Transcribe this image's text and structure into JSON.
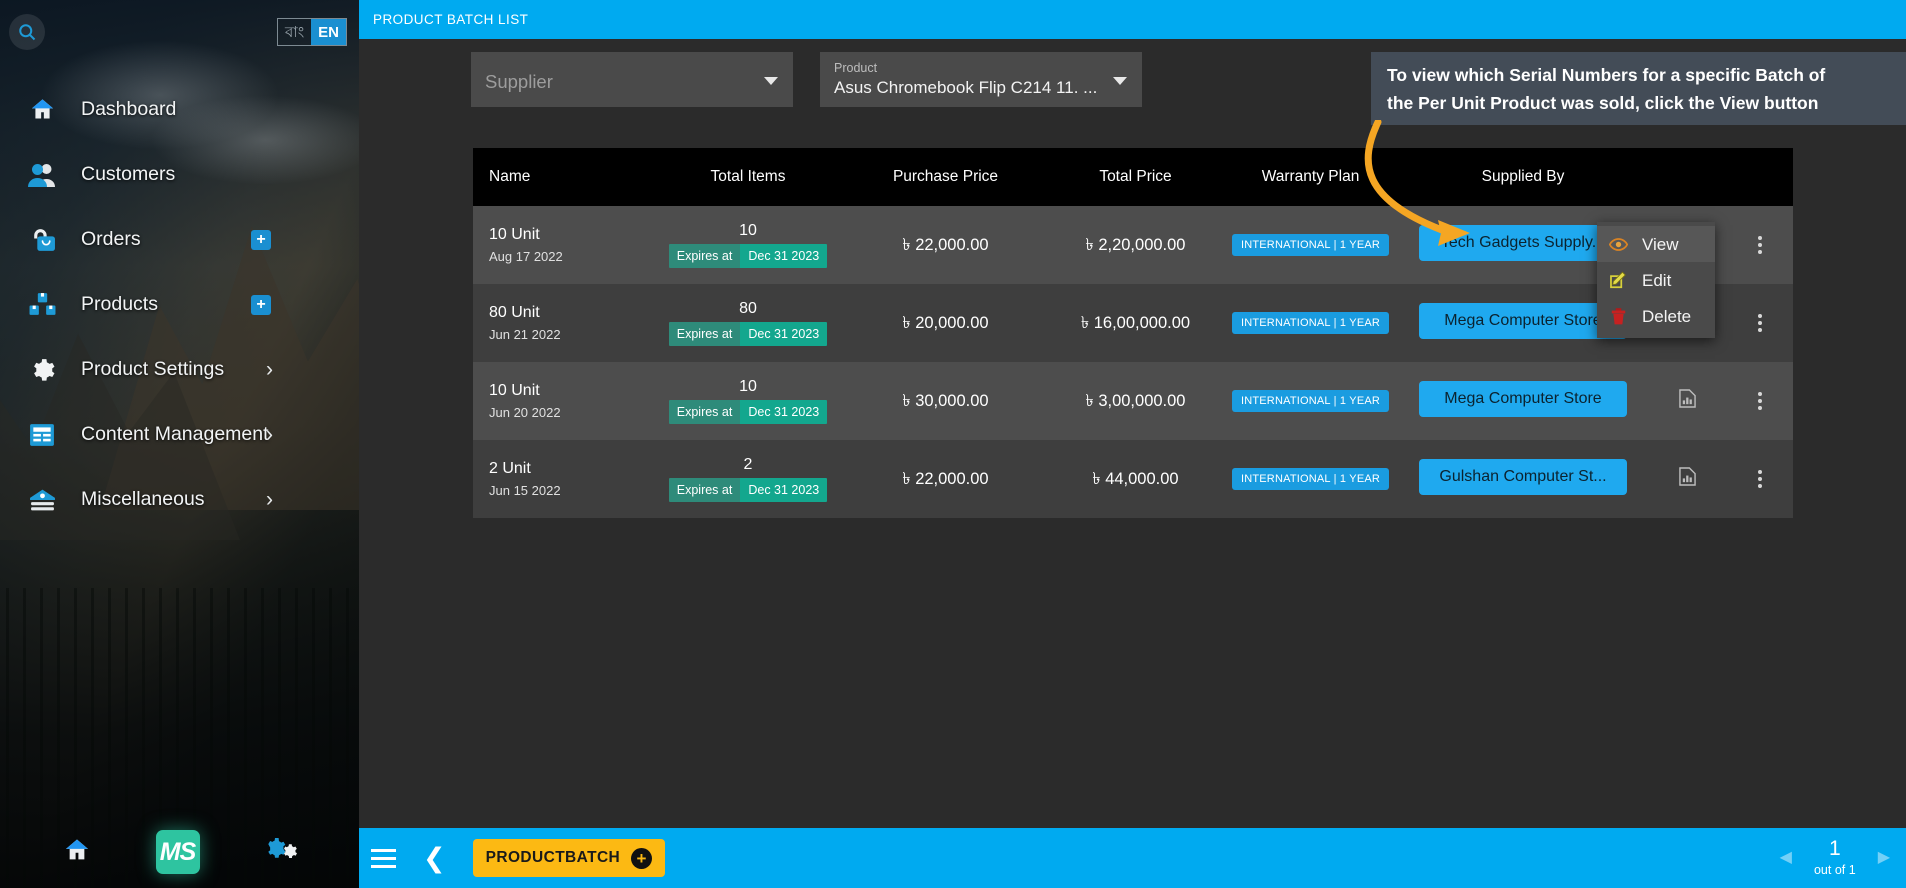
{
  "sidebar": {
    "search_icon": "search-icon",
    "lang": {
      "bn": "বাং",
      "en": "EN",
      "active": "EN"
    },
    "items": [
      {
        "label": "Dashboard",
        "icon": "home-icon",
        "badge": null,
        "chevron": false
      },
      {
        "label": "Customers",
        "icon": "customers-icon",
        "badge": null,
        "chevron": false
      },
      {
        "label": "Orders",
        "icon": "orders-bag-icon",
        "badge": "+",
        "chevron": false
      },
      {
        "label": "Products",
        "icon": "products-boxes-icon",
        "badge": "+",
        "chevron": false
      },
      {
        "label": "Product Settings",
        "icon": "gear-icon",
        "badge": null,
        "chevron": true
      },
      {
        "label": "Content Management",
        "icon": "content-list-icon",
        "badge": null,
        "chevron": true
      },
      {
        "label": "Miscellaneous",
        "icon": "misc-icon",
        "badge": null,
        "chevron": true
      }
    ],
    "footer": {
      "home_icon": "home-icon",
      "logo_text": "MS",
      "settings_icon": "gears-icon"
    }
  },
  "header": {
    "title": "PRODUCT BATCH LIST"
  },
  "filters": {
    "supplier": {
      "placeholder": "Supplier"
    },
    "product": {
      "label": "Product",
      "value": "Asus Chromebook Flip C214 11.  ..."
    }
  },
  "callout": {
    "line1": "To view which Serial Numbers for a specific Batch of",
    "line2": "the Per Unit Product was sold, click the View button",
    "arrow_color": "#f5a623"
  },
  "table": {
    "columns": [
      "Name",
      "Total Items",
      "Purchase Price",
      "Total Price",
      "Warranty Plan",
      "Supplied By"
    ],
    "expires_label": "Expires at",
    "rows": [
      {
        "name": "10 Unit",
        "date": "Aug 17 2022",
        "qty": "10",
        "expires_at": "Dec 31 2023",
        "purchase_price": "৳ 22,000.00",
        "total_price": "৳ 2,20,000.00",
        "warranty": "INTERNATIONAL | 1 YEAR",
        "supplier": "Tech Gadgets Supply...",
        "has_chart_icon": false
      },
      {
        "name": "80 Unit",
        "date": "Jun 21 2022",
        "qty": "80",
        "expires_at": "Dec 31 2023",
        "purchase_price": "৳ 20,000.00",
        "total_price": "৳ 16,00,000.00",
        "warranty": "INTERNATIONAL | 1 YEAR",
        "supplier": "Mega Computer Store",
        "has_chart_icon": false
      },
      {
        "name": "10 Unit",
        "date": "Jun 20 2022",
        "qty": "10",
        "expires_at": "Dec 31 2023",
        "purchase_price": "৳ 30,000.00",
        "total_price": "৳ 3,00,000.00",
        "warranty": "INTERNATIONAL | 1 YEAR",
        "supplier": "Mega Computer Store",
        "has_chart_icon": true
      },
      {
        "name": "2 Unit",
        "date": "Jun 15 2022",
        "qty": "2",
        "expires_at": "Dec 31 2023",
        "purchase_price": "৳ 22,000.00",
        "total_price": "৳ 44,000.00",
        "warranty": "INTERNATIONAL | 1 YEAR",
        "supplier": "Gulshan Computer St...",
        "has_chart_icon": true
      }
    ]
  },
  "context_menu": {
    "items": [
      {
        "label": "View",
        "icon": "eye-icon",
        "highlighted": true
      },
      {
        "label": "Edit",
        "icon": "pencil-icon",
        "highlighted": false
      },
      {
        "label": "Delete",
        "icon": "trash-icon",
        "highlighted": false
      }
    ]
  },
  "bottombar": {
    "menu_icon": "hamburger-icon",
    "back_icon": "chevron-left-icon",
    "add_label": "PRODUCTBATCH",
    "add_plus": "+",
    "pager": {
      "prev": "◀",
      "page": "1",
      "out_of": "out of 1",
      "next": "▶"
    }
  },
  "colors": {
    "accent_blue": "#00aaf0",
    "yellow": "#fcb913",
    "teal": "#13a78e",
    "panel": "#4d4d4d"
  }
}
